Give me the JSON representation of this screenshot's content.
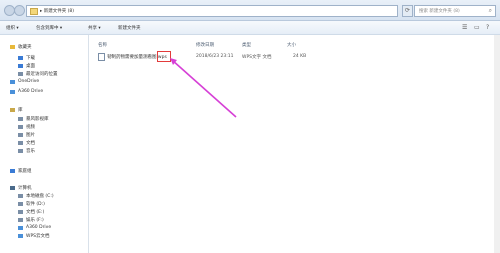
{
  "window": {
    "breadcrumb": "▸ 新建文件夹 (8)",
    "search_placeholder": "搜索 新建文件夹 (8)"
  },
  "toolbar": {
    "organize": "组织 ▾",
    "include": "包含到库中 ▾",
    "share": "共享 ▾",
    "new_folder": "新建文件夹"
  },
  "sidebar": {
    "items": [
      {
        "label": "收藏夹",
        "icon": "star-icon",
        "color": "#e8b93a"
      },
      {
        "label": "下载",
        "icon": "download-folder-icon",
        "color": "#3a7bd5"
      },
      {
        "label": "桌面",
        "icon": "desktop-icon",
        "color": "#3a7bd5"
      },
      {
        "label": "最近访问的位置",
        "icon": "recent-places-icon",
        "color": "#7a8ea6"
      },
      {
        "label": "OneDrive",
        "icon": "cloud-icon",
        "color": "#4a90d9"
      },
      {
        "label": "A360 Drive",
        "icon": "cloud-icon",
        "color": "#4a90d9"
      },
      {
        "label": "库",
        "icon": "library-icon",
        "color": "#c9a84a"
      },
      {
        "label": "暴风影视库",
        "icon": "video-library-icon",
        "color": "#7a8ea6"
      },
      {
        "label": "视频",
        "icon": "video-icon",
        "color": "#7a8ea6"
      },
      {
        "label": "图片",
        "icon": "picture-icon",
        "color": "#7a8ea6"
      },
      {
        "label": "文档",
        "icon": "documents-icon",
        "color": "#7a8ea6"
      },
      {
        "label": "音乐",
        "icon": "music-icon",
        "color": "#7a8ea6"
      },
      {
        "label": "家庭组",
        "icon": "homegroup-icon",
        "color": "#3a7bd5"
      },
      {
        "label": "计算机",
        "icon": "computer-icon",
        "color": "#4a6a8a"
      },
      {
        "label": "本地磁盘 (C:)",
        "icon": "drive-icon",
        "color": "#7a8ea6"
      },
      {
        "label": "软件 (D:)",
        "icon": "drive-icon",
        "color": "#7a8ea6"
      },
      {
        "label": "文档 (E:)",
        "icon": "drive-icon",
        "color": "#7a8ea6"
      },
      {
        "label": "娱乐 (F:)",
        "icon": "drive-icon",
        "color": "#7a8ea6"
      },
      {
        "label": "A360 Drive",
        "icon": "cloud-icon",
        "color": "#4a90d9"
      },
      {
        "label": "WPS云文档",
        "icon": "cloud-icon",
        "color": "#4a90d9"
      }
    ]
  },
  "columns": {
    "name": "名称",
    "date": "修改日期",
    "type": "类型",
    "size": "大小"
  },
  "file": {
    "name": "韧制药物需要加量测看图.wps",
    "date": "2018/6/23 23:11",
    "type": "WPS文字 文档",
    "size": "24 KB"
  },
  "annotation": {
    "highlight_color": "#e23b3b",
    "arrow_color": "#d640d6"
  }
}
